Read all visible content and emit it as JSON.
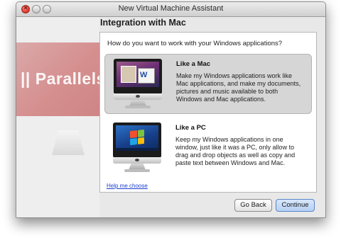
{
  "window": {
    "title": "New Virtual Machine Assistant"
  },
  "promo": {
    "logo_text": "|| Parallels"
  },
  "header": {
    "title": "Integration with Mac"
  },
  "panel": {
    "question": "How do you want to work with your Windows applications?",
    "options": [
      {
        "title": "Like a Mac",
        "description": "Make my Windows applications work like Mac applications, and make my documents, pictures and music available to both Windows and Mac applications.",
        "selected": true
      },
      {
        "title": "Like a PC",
        "description": "Keep my Windows applications in one window, just like it was a PC, only allow to drag and drop objects as well as copy and paste text between Windows and Mac.",
        "selected": false
      }
    ],
    "help_link": "Help me choose"
  },
  "buttons": {
    "back": "Go Back",
    "continue": "Continue"
  },
  "colors": {
    "accent": "#5a85c8",
    "selected_option_bg": "#d6d6d6",
    "link": "#1b3fd0"
  }
}
